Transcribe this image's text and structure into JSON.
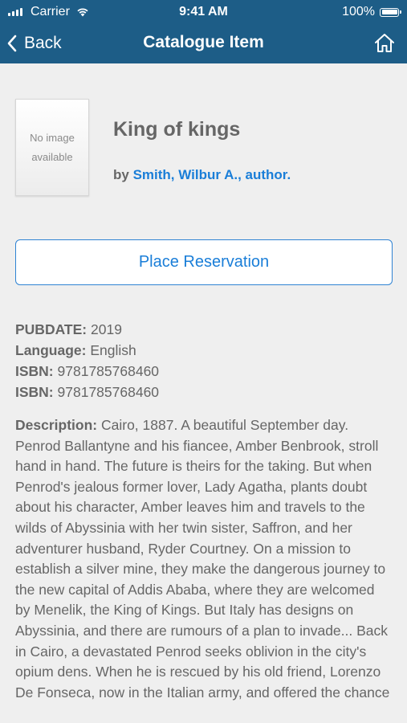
{
  "status_bar": {
    "carrier": "Carrier",
    "time": "9:41 AM",
    "battery": "100%"
  },
  "nav": {
    "back_label": "Back",
    "title": "Catalogue Item",
    "home_icon": "home-icon"
  },
  "item": {
    "cover_placeholder": "No image\navailable",
    "title": "King of kings",
    "by_prefix": "by",
    "author": "Smith, Wilbur A., author."
  },
  "actions": {
    "place_reservation": "Place Reservation"
  },
  "details": {
    "pubdate_label": "PUBDATE:",
    "pubdate": "2019",
    "language_label": "Language:",
    "language": "English",
    "isbn_label": "ISBN:",
    "isbn_1": "9781785768460",
    "isbn_2": "9781785768460",
    "description_label": "Description:",
    "description": "Cairo, 1887. A beautiful September day. Penrod Ballantyne and his fiancee, Amber Benbrook, stroll hand in hand. The future is theirs for the taking. But when Penrod's jealous former lover, Lady Agatha, plants doubt about his character, Amber leaves him and travels to the wilds of Abyssinia with her twin sister, Saffron, and her adventurer husband, Ryder Courtney. On a mission to establish a silver mine, they make the dangerous journey to the new capital of Addis Ababa, where they are welcomed by Menelik, the King of Kings. But Italy has designs on Abyssinia, and there are rumours of a plan to invade... Back in Cairo, a devastated Penrod seeks oblivion in the city's opium dens. When he is rescued by his old friend, Lorenzo De Fonseca, now in the Italian army, and offered the chance"
  },
  "colors": {
    "header_bg": "#1d5d87",
    "link": "#1a7ed8",
    "text": "#666666",
    "page_bg": "#efefef"
  }
}
